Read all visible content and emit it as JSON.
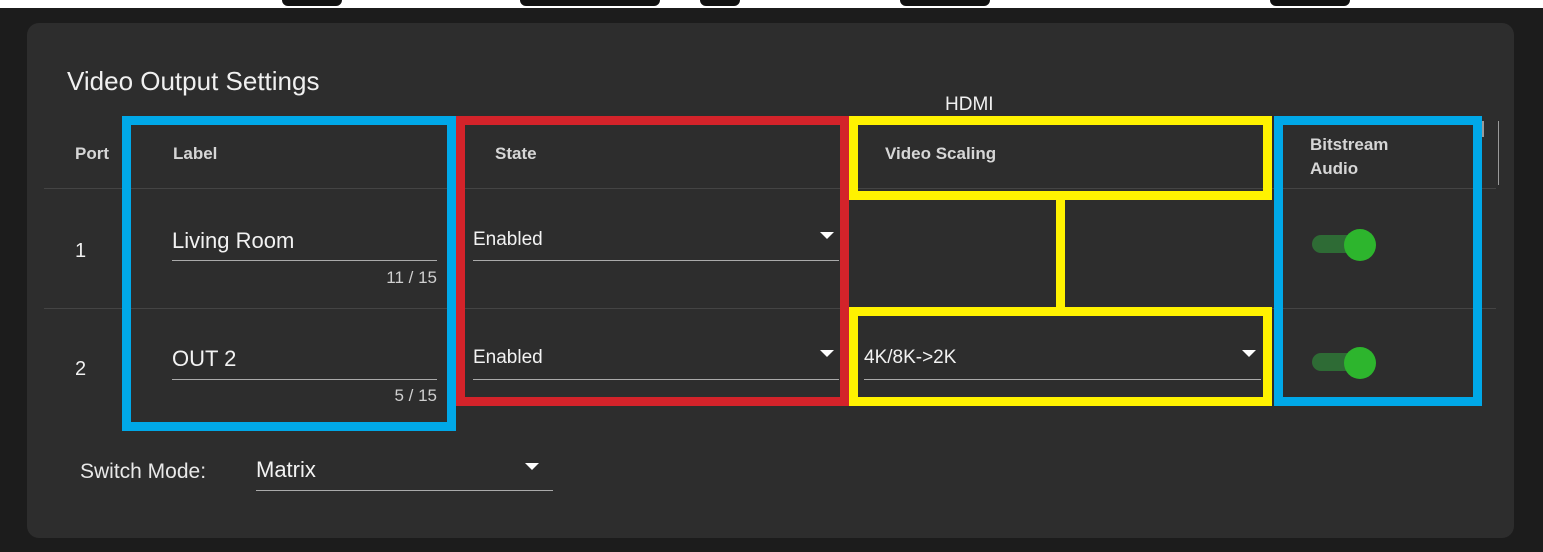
{
  "panel": {
    "title": "Video Output Settings",
    "group_header": "HDMI"
  },
  "columns": {
    "port": "Port",
    "label": "Label",
    "state": "State",
    "video_scaling": "Video Scaling",
    "bitstream_line1": "Bitstream",
    "bitstream_line2": "Audio"
  },
  "rows": [
    {
      "port": "1",
      "label_value": "Living Room",
      "label_counter": "11 / 15",
      "state": "Enabled",
      "video_scaling": "",
      "bitstream_audio": true
    },
    {
      "port": "2",
      "label_value": "OUT 2",
      "label_counter": "5 / 15",
      "state": "Enabled",
      "video_scaling": "4K/8K->2K",
      "bitstream_audio": true
    }
  ],
  "switch_mode": {
    "label": "Switch Mode:",
    "value": "Matrix"
  },
  "colors": {
    "background": "#1c1c1c",
    "panel": "#2d2d2d",
    "highlight_blue": "#00a8e8",
    "highlight_red": "#d3232a",
    "highlight_yellow": "#fff200",
    "toggle_on": "#2db52d"
  },
  "icons": {
    "dropdown": "caret-down-icon"
  }
}
